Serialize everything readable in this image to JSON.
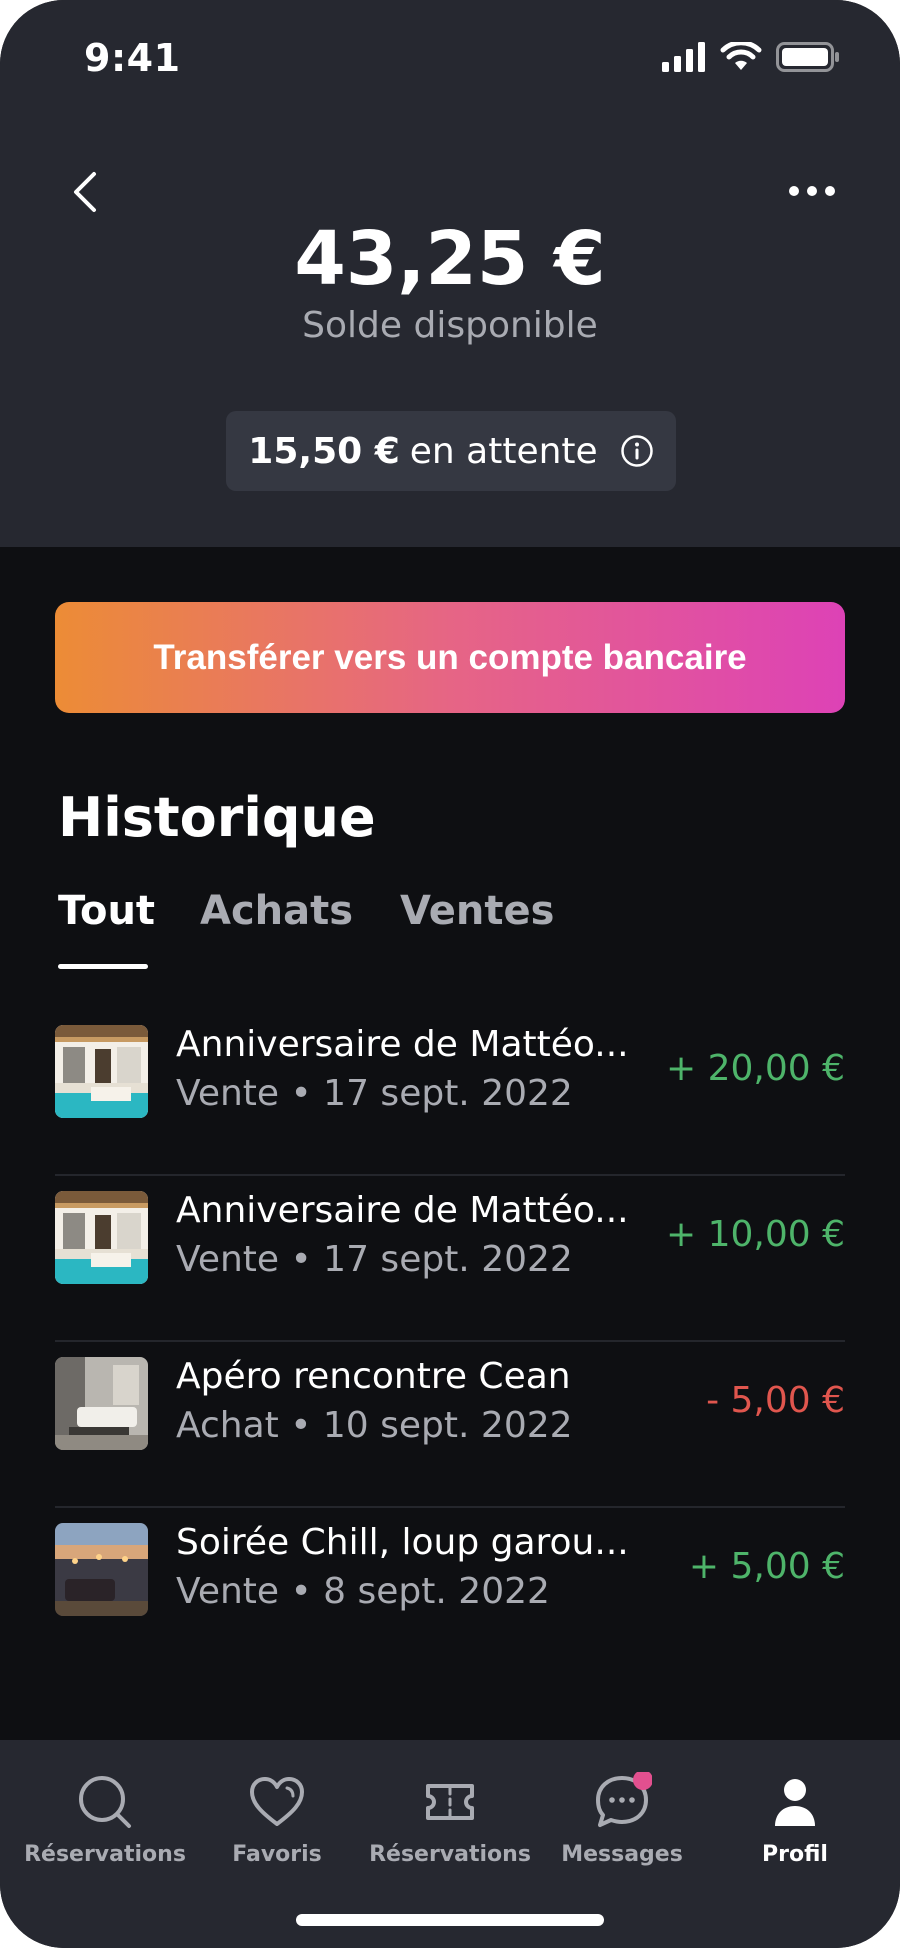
{
  "status_bar": {
    "time": "9:41"
  },
  "header": {
    "balance": "43,25 €",
    "balance_label": "Solde disponible",
    "pending_amount": "15,50 €",
    "pending_label": "en attente"
  },
  "transfer_button": {
    "label": "Transférer vers un compte bancaire"
  },
  "history": {
    "title": "Historique",
    "tabs": [
      {
        "label": "Tout",
        "active": true
      },
      {
        "label": "Achats",
        "active": false
      },
      {
        "label": "Ventes",
        "active": false
      }
    ],
    "transactions": [
      {
        "title": "Anniversaire de Mattéo...",
        "subtitle": "Vente • 17 sept. 2022",
        "amount": "+ 20,00 €",
        "type": "positive"
      },
      {
        "title": "Anniversaire de Mattéo...",
        "subtitle": "Vente • 17 sept. 2022",
        "amount": "+ 10,00 €",
        "type": "positive"
      },
      {
        "title": "Apéro rencontre Cean",
        "subtitle": "Achat • 10 sept. 2022",
        "amount": "- 5,00 €",
        "type": "negative"
      },
      {
        "title": "Soirée Chill, loup garou...",
        "subtitle": "Vente • 8 sept. 2022",
        "amount": "+ 5,00 €",
        "type": "positive"
      }
    ]
  },
  "tab_bar": {
    "items": [
      {
        "label": "Réservations",
        "icon": "search-icon"
      },
      {
        "label": "Favoris",
        "icon": "heart-icon"
      },
      {
        "label": "Réservations",
        "icon": "ticket-icon"
      },
      {
        "label": "Messages",
        "icon": "chat-icon"
      },
      {
        "label": "Profil",
        "icon": "user-icon",
        "active": true
      }
    ]
  },
  "colors": {
    "header_bg": "#262830",
    "page_bg": "#0e0f12",
    "positive": "#4eb46a",
    "negative": "#e0564e",
    "gradient_start": "#ec8c36",
    "gradient_end": "#dd42b6",
    "badge": "#e2508f"
  }
}
